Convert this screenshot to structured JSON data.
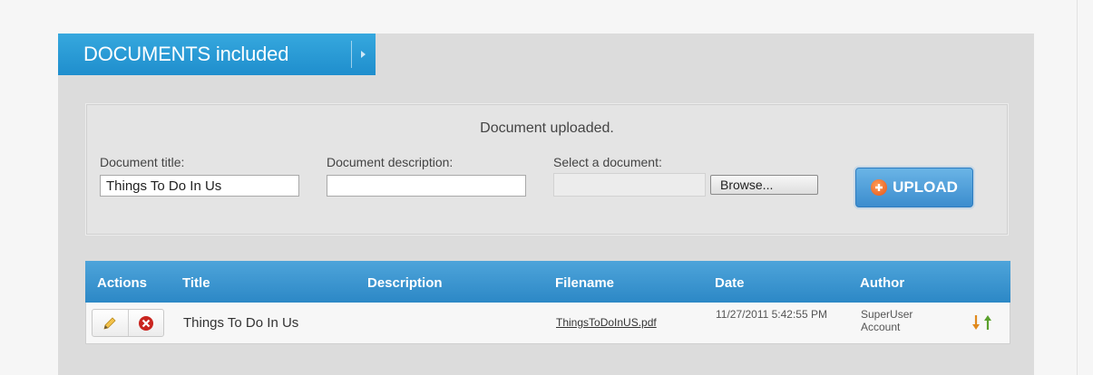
{
  "header": {
    "title": "DOCUMENTS included"
  },
  "form": {
    "status_message": "Document uploaded.",
    "title_label": "Document title:",
    "title_value": "Things To Do In Us",
    "description_label": "Document description:",
    "description_value": "",
    "select_label": "Select a document:",
    "browse_label": "Browse...",
    "upload_label": "UPLOAD"
  },
  "table": {
    "columns": {
      "actions": "Actions",
      "title": "Title",
      "description": "Description",
      "filename": "Filename",
      "date": "Date",
      "author": "Author"
    },
    "rows": [
      {
        "title": "Things To Do In Us",
        "description": "",
        "filename": "ThingsToDoInUS.pdf",
        "date": "11/27/2011 5:42:55 PM",
        "author": "SuperUser Account"
      }
    ]
  },
  "colors": {
    "header_blue": "#1f8ecd",
    "upload_orange": "#e2571b",
    "delete_red": "#c9251f",
    "sort_down": "#e08a1e",
    "sort_up": "#5aa02c"
  },
  "icons": [
    "chevron-right-icon",
    "plus-circle-icon",
    "pencil-icon",
    "delete-icon",
    "sort-down-icon",
    "sort-up-icon"
  ]
}
